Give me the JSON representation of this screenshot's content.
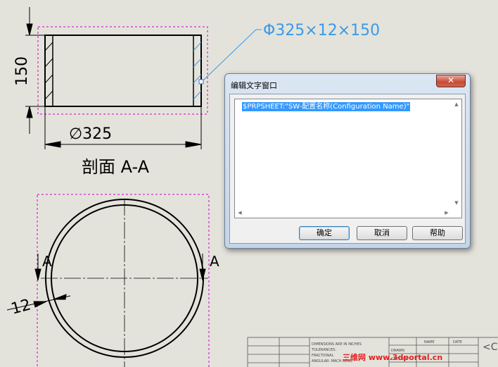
{
  "drawing": {
    "pipe_spec_note": "Φ325×12×150",
    "height_dim": "150",
    "diameter_dim": "∅325",
    "section_label": "剖面 A-A",
    "section_marker_left": "A",
    "section_marker_right": "A",
    "thickness_dim": "12"
  },
  "title_block": {
    "notes": [
      "DIMENSIONS ARE IN INCHES",
      "TOLERANCES:",
      "FRACTIONAL",
      "ANGULAR: MACH   BEND"
    ],
    "drawn_label": "DRAWN",
    "checked_label": "CHECKED",
    "name_header": "NAME",
    "date_header": "DATE",
    "title_fragment": "<C"
  },
  "dialog": {
    "title": "编辑文字窗口",
    "close_glyph": "✕",
    "text_value": "$PRPSHEET:\"SW-配置名称(Configuration Name)\"",
    "ok_label": "确定",
    "cancel_label": "取消",
    "help_label": "帮助"
  },
  "watermark": "三维网 www.3dportal.cn",
  "colors": {
    "background": "#e4e3db",
    "line": "#000000",
    "construction": "#cc00cc",
    "note_blue": "#3a9ae8",
    "selection": "#3399ff"
  },
  "icons": [
    "scroll-up-arrow-icon",
    "scroll-down-arrow-icon",
    "scroll-left-arrow-icon",
    "scroll-right-arrow-icon",
    "close-icon"
  ]
}
